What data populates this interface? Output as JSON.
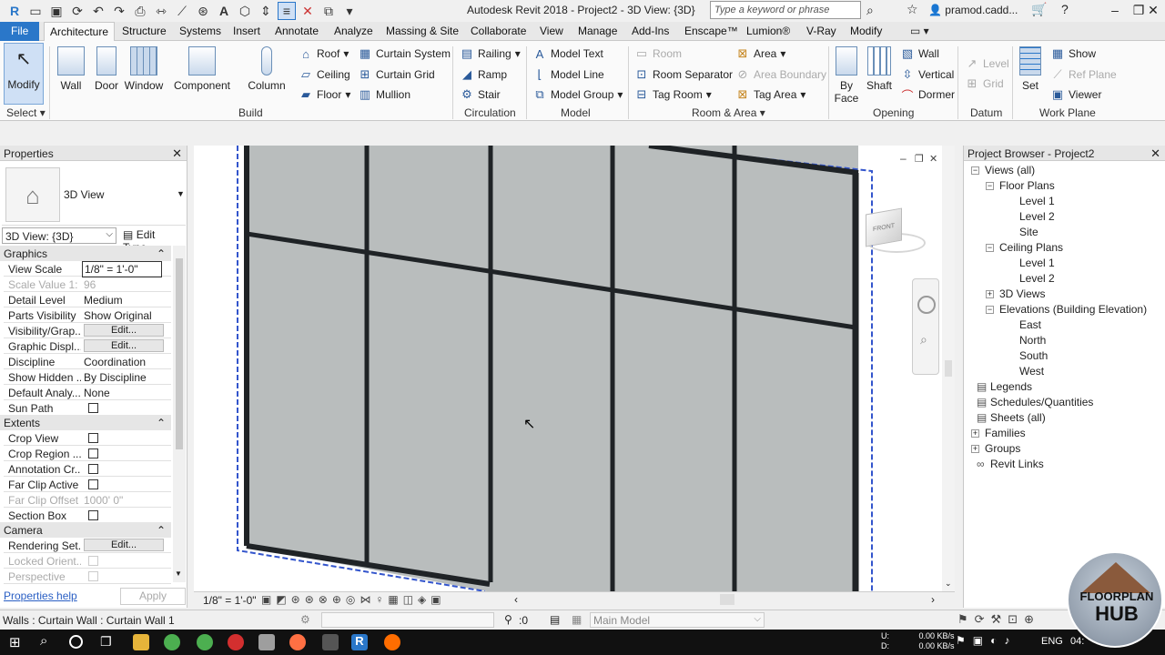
{
  "titlebar": {
    "title": "Autodesk Revit 2018 -   Project2 - 3D View: {3D}",
    "search_placeholder": "Type a keyword or phrase",
    "user": "pramod.cadd...",
    "qat_icons": [
      "revit-r-icon",
      "open-icon",
      "save-icon",
      "sync-icon",
      "undo-icon",
      "redo-icon",
      "print-icon",
      "measure-icon",
      "dimension-icon",
      "tag-icon",
      "text-icon",
      "3d-view-icon",
      "sections-icon",
      "thin-lines-icon",
      "close-hidden-icon",
      "switch-windows-icon",
      "customize-qat-icon"
    ]
  },
  "tabs": [
    "File",
    "Architecture",
    "Structure",
    "Systems",
    "Insert",
    "Annotate",
    "Analyze",
    "Massing & Site",
    "Collaborate",
    "View",
    "Manage",
    "Add-Ins",
    "Enscape™",
    "Lumion®",
    "V-Ray",
    "Modify"
  ],
  "ribbon": {
    "select": {
      "modify": "Modify",
      "select_label": "Select"
    },
    "build": {
      "wall": "Wall",
      "door": "Door",
      "window": "Window",
      "component": "Component",
      "column": "Column",
      "roof": "Roof",
      "ceiling": "Ceiling",
      "floor": "Floor",
      "curtain_system": "Curtain System",
      "curtain_grid": "Curtain Grid",
      "mullion": "Mullion",
      "label": "Build"
    },
    "circulation": {
      "railing": "Railing",
      "ramp": "Ramp",
      "stair": "Stair",
      "label": "Circulation"
    },
    "model": {
      "model_text": "Model  Text",
      "model_line": "Model  Line",
      "model_group": "Model  Group",
      "label": "Model"
    },
    "room_area": {
      "room": "Room",
      "room_separator": "Room  Separator",
      "tag_room": "Tag  Room",
      "area": "Area",
      "area_boundary": "Area  Boundary",
      "tag_area": "Tag  Area",
      "label": "Room & Area"
    },
    "opening": {
      "by_face_1": "By",
      "by_face_2": "Face",
      "shaft": "Shaft",
      "wall": "Wall",
      "vertical": "Vertical",
      "dormer": "Dormer",
      "label": "Opening"
    },
    "datum": {
      "level": "Level",
      "grid": "Grid",
      "label": "Datum"
    },
    "work_plane": {
      "set": "Set",
      "show": "Show",
      "ref_plane": "Ref  Plane",
      "viewer": "Viewer",
      "label": "Work Plane"
    }
  },
  "properties": {
    "title": "Properties",
    "type_name": "3D View",
    "instance_selector": "3D View: {3D}",
    "edit_type": "Edit Type",
    "sections": {
      "graphics": "Graphics",
      "extents": "Extents",
      "camera": "Camera"
    },
    "graphics_rows": [
      {
        "k": "View Scale",
        "v": "1/8\" = 1'-0\""
      },
      {
        "k": "Scale Value    1:",
        "v": "96"
      },
      {
        "k": "Detail Level",
        "v": "Medium"
      },
      {
        "k": "Parts Visibility",
        "v": "Show Original"
      },
      {
        "k": "Visibility/Grap...",
        "v": "Edit..."
      },
      {
        "k": "Graphic Displ...",
        "v": "Edit..."
      },
      {
        "k": "Discipline",
        "v": "Coordination"
      },
      {
        "k": "Show Hidden ...",
        "v": "By Discipline"
      },
      {
        "k": "Default Analy...",
        "v": "None"
      },
      {
        "k": "Sun Path",
        "v": ""
      }
    ],
    "extents_rows": [
      {
        "k": "Crop View",
        "v": ""
      },
      {
        "k": "Crop Region ...",
        "v": ""
      },
      {
        "k": "Annotation Cr...",
        "v": ""
      },
      {
        "k": "Far Clip Active",
        "v": ""
      },
      {
        "k": "Far Clip Offset",
        "v": "1000'  0\""
      },
      {
        "k": "Section Box",
        "v": ""
      }
    ],
    "camera_rows": [
      {
        "k": "Rendering Set...",
        "v": "Edit..."
      },
      {
        "k": "Locked Orient...",
        "v": ""
      },
      {
        "k": "Perspective",
        "v": ""
      }
    ],
    "help": "Properties help",
    "apply": "Apply"
  },
  "viewbar": {
    "scale": "1/8\" = 1'-0\""
  },
  "browser": {
    "title": "Project Browser - Project2",
    "items": [
      {
        "label": "Views (all)",
        "level": 0,
        "toggle": "−"
      },
      {
        "label": "Floor Plans",
        "level": 1,
        "toggle": "−"
      },
      {
        "label": "Level 1",
        "level": 2,
        "toggle": ""
      },
      {
        "label": "Level 2",
        "level": 2,
        "toggle": ""
      },
      {
        "label": "Site",
        "level": 2,
        "toggle": ""
      },
      {
        "label": "Ceiling Plans",
        "level": 1,
        "toggle": "−"
      },
      {
        "label": "Level 1",
        "level": 2,
        "toggle": ""
      },
      {
        "label": "Level 2",
        "level": 2,
        "toggle": ""
      },
      {
        "label": "3D Views",
        "level": 1,
        "toggle": "+"
      },
      {
        "label": "Elevations (Building Elevation)",
        "level": 1,
        "toggle": "−"
      },
      {
        "label": "East",
        "level": 2,
        "toggle": ""
      },
      {
        "label": "North",
        "level": 2,
        "toggle": ""
      },
      {
        "label": "South",
        "level": 2,
        "toggle": ""
      },
      {
        "label": "West",
        "level": 2,
        "toggle": ""
      },
      {
        "label": "Legends",
        "level": 0,
        "toggle": ""
      },
      {
        "label": "Schedules/Quantities",
        "level": 0,
        "toggle": ""
      },
      {
        "label": "Sheets (all)",
        "level": 0,
        "toggle": ""
      },
      {
        "label": "Families",
        "level": 0,
        "toggle": "+"
      },
      {
        "label": "Groups",
        "level": 0,
        "toggle": "+"
      },
      {
        "label": "Revit Links",
        "level": 0,
        "toggle": ""
      }
    ]
  },
  "status": {
    "message": "Walls : Curtain Wall : Curtain Wall 1",
    "workset_value": ":0",
    "model": "Main Model"
  },
  "taskbar": {
    "lang": "ENG",
    "net_up": "0.00 KB/s",
    "net_down": "0.00 KB/s",
    "net_u_label": "U:",
    "net_d_label": "D:",
    "time": "04:"
  },
  "logo": {
    "line1": "FLOORPLAN",
    "line2": "HUB"
  },
  "colors": {
    "accent": "#2a77c9",
    "glass": "#b9bdbd",
    "mullion": "#1f2326",
    "selection": "#3355cc"
  }
}
